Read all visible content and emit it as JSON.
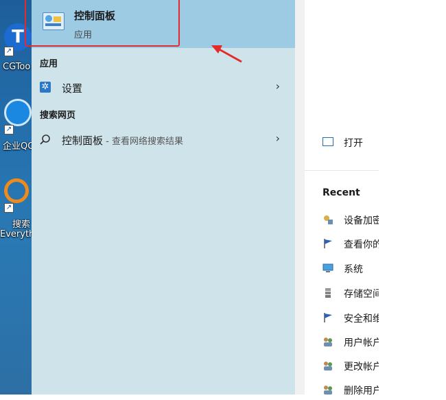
{
  "desktop": {
    "icons": [
      {
        "label": "CGToo",
        "icon": "cgtool-icon"
      },
      {
        "label": "企业QC",
        "icon": "enterprise-qq-icon"
      },
      {
        "label_line1": "搜索",
        "label_line2": "Everyth",
        "icon": "everything-search-icon"
      }
    ]
  },
  "best_match": {
    "title": "控制面板",
    "subtitle": "应用"
  },
  "sections": {
    "apps_header": "应用",
    "web_header": "搜索网页"
  },
  "apps": [
    {
      "label": "设置",
      "icon": "gear-icon"
    }
  ],
  "web": [
    {
      "label": "控制面板",
      "suffix": " - 查看网络搜索结果",
      "icon": "search-icon"
    }
  ],
  "details": {
    "open_label": "打开",
    "recent_header": "Recent",
    "recent_items": [
      {
        "label": "设备加密",
        "icon": "device-encryption-icon"
      },
      {
        "label": "查看你的",
        "icon": "flag-icon"
      },
      {
        "label": "系统",
        "icon": "monitor-icon"
      },
      {
        "label": "存储空间",
        "icon": "storage-icon"
      },
      {
        "label": "安全和维",
        "icon": "flag-icon"
      },
      {
        "label": "用户帐户",
        "icon": "users-icon"
      },
      {
        "label": "更改帐户",
        "icon": "users-icon"
      },
      {
        "label": "删除用户",
        "icon": "users-icon"
      }
    ]
  },
  "colors": {
    "highlight": "#9dcbe4",
    "pane": "#cfe4ea",
    "annotation_red": "#e42b2b",
    "accent_blue": "#2b78c8"
  }
}
